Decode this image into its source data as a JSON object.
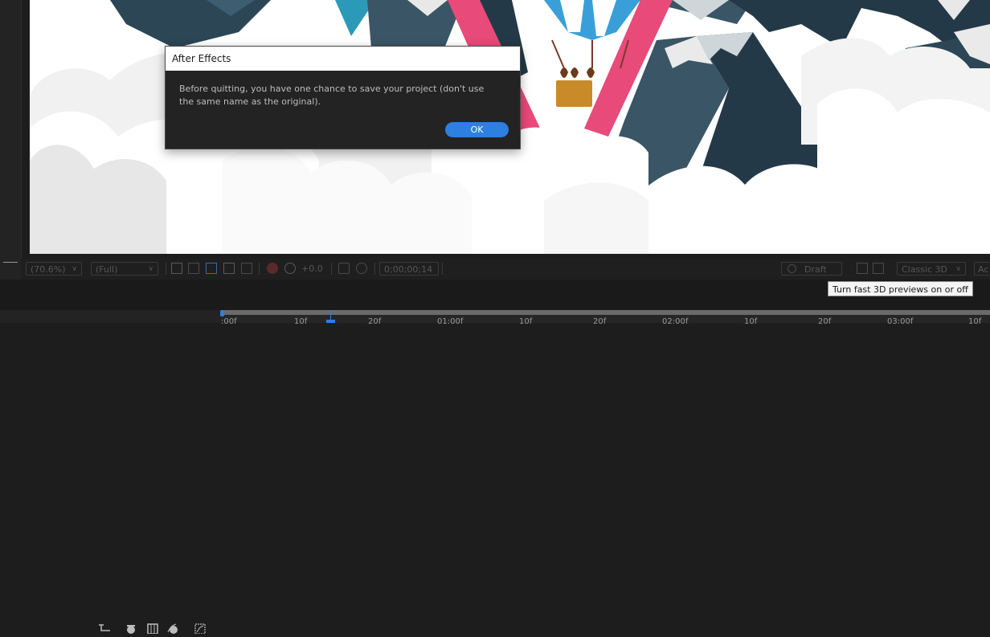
{
  "dialog": {
    "title": "After Effects",
    "message": "Before quitting, you have one chance to save your project (don't use the same name as the original).",
    "ok_label": "OK"
  },
  "viewer_bar": {
    "magnification": "(70.6%)",
    "resolution": "(Full)",
    "exposure": "+0.0",
    "timecode": "0;00;00;14",
    "draft_3d": "Draft 3D",
    "renderer": "Classic 3D",
    "truncated_label": "Ac"
  },
  "tooltip": {
    "text": "Turn fast 3D previews on or off"
  },
  "timeline": {
    "ticks": [
      ":00f",
      "10f",
      "20f",
      "01:00f",
      "10f",
      "20f",
      "02:00f",
      "10f",
      "20f",
      "03:00f",
      "10f"
    ]
  },
  "colors": {
    "accent": "#2d7fe0",
    "balloon_pink": "#e84a7a",
    "balloon_blue": "#3a9fd8",
    "mountain_dark": "#243947",
    "mountain_mid": "#3a5566",
    "basket": "#c98a2a"
  },
  "icons": [
    "region-of-interest-icon",
    "transparency-grid-icon",
    "mask-visibility-icon",
    "guides-icon",
    "color-channel-icon",
    "exposure-reset-icon",
    "snapshot-camera-icon",
    "show-snapshot-icon",
    "draft-3d-icon",
    "3d-view-icon",
    "timeline-tool-icons"
  ]
}
